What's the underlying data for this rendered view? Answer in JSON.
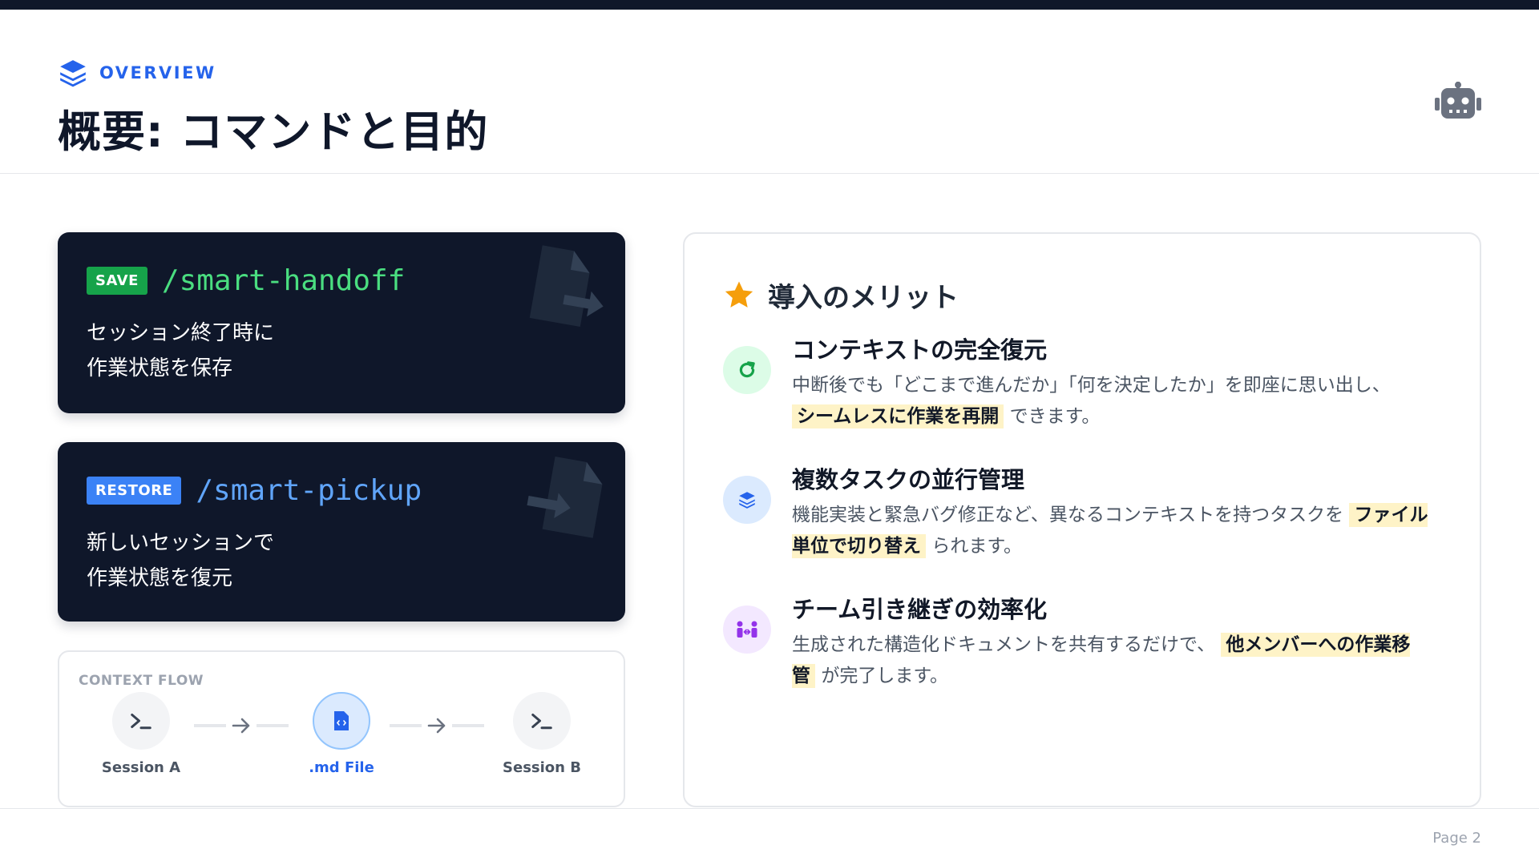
{
  "header": {
    "eyebrow": "OVERVIEW",
    "title": "概要: コマンドと目的"
  },
  "commands": {
    "save": {
      "badge": "SAVE",
      "name": "/smart-handoff",
      "desc_line1": "セッション終了時に",
      "desc_line2": "作業状態を保存"
    },
    "restore": {
      "badge": "RESTORE",
      "name": "/smart-pickup",
      "desc_line1": "新しいセッションで",
      "desc_line2": "作業状態を復元"
    }
  },
  "flow": {
    "label": "CONTEXT FLOW",
    "nodes": [
      {
        "label": "Session A"
      },
      {
        "label": ".md File"
      },
      {
        "label": "Session B"
      }
    ]
  },
  "benefits": {
    "title": "導入のメリット",
    "items": [
      {
        "title": "コンテキストの完全復元",
        "text_before": "中断後でも「どこまで進んだか」「何を決定したか」を即座に思い出し、",
        "highlight": "シームレスに作業を再開",
        "text_after": "できます。"
      },
      {
        "title": "複数タスクの並行管理",
        "text_before": "機能実装と緊急バグ修正など、異なるコンテキストを持つタスクを",
        "highlight": "ファイル単位で切り替え",
        "text_after": "られます。"
      },
      {
        "title": "チーム引き継ぎの効率化",
        "text_before": "生成された構造化ドキュメントを共有するだけで、",
        "highlight": "他メンバーへの作業移管",
        "text_after": "が完了します。"
      }
    ]
  },
  "footer": {
    "page": "Page 2"
  },
  "colors": {
    "dark": "#0f172a",
    "accent_blue": "#2563eb",
    "save_green": "#16a34a",
    "restore_blue": "#3b82f6",
    "star": "#f59e0b",
    "highlight": "#fef3c7"
  }
}
